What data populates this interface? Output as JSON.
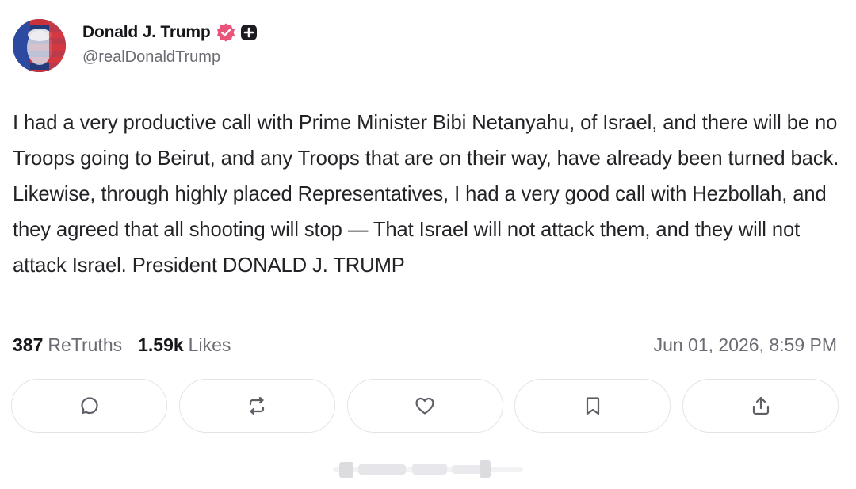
{
  "author": {
    "display_name": "Donald J. Trump",
    "handle": "@realDonaldTrump",
    "avatar_icon": "avatar-flag-portrait",
    "verified_icon": "verified-badge-icon",
    "verified_color": "#e8547a",
    "badge_icon": "plus-badge-icon"
  },
  "post": {
    "text": "I had a very productive call with Prime Minister Bibi Netanyahu, of Israel, and there will be no Troops going to Beirut, and any Troops that are on their way, have already been turned back. Likewise, through highly placed Representatives, I had a very good call with Hezbollah, and they agreed that all shooting will stop — That Israel will not attack them, and they will not attack Israel. President DONALD J. TRUMP"
  },
  "stats": {
    "retruths_count": "387",
    "retruths_label": "ReTruths",
    "likes_count": "1.59k",
    "likes_label": "Likes",
    "timestamp": "Jun 01, 2026, 8:59 PM"
  },
  "actions": [
    {
      "name": "reply",
      "icon": "reply-icon"
    },
    {
      "name": "retruth",
      "icon": "retruth-icon"
    },
    {
      "name": "like",
      "icon": "heart-icon"
    },
    {
      "name": "bookmark",
      "icon": "bookmark-icon"
    },
    {
      "name": "share",
      "icon": "share-icon"
    }
  ],
  "colors": {
    "text": "#232327",
    "muted": "#6b6b73",
    "border": "#e3e3e8",
    "icon": "#5e5e66"
  }
}
